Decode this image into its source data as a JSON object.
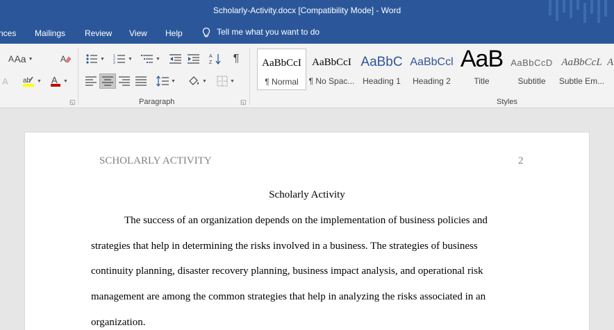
{
  "window": {
    "title": "Scholarly-Activity.docx [Compatibility Mode]  -  Word"
  },
  "ribbon_tabs": [
    {
      "label": "nces"
    },
    {
      "label": "Mailings"
    },
    {
      "label": "Review"
    },
    {
      "label": "View"
    },
    {
      "label": "Help"
    }
  ],
  "tell_me": {
    "label": "Tell me what you want to do",
    "icon": "lightbulb-icon"
  },
  "groups": {
    "paragraph_label": "Paragraph",
    "styles_label": "Styles"
  },
  "font_controls": {
    "font_size_glyph": "Aa",
    "grow_glyph": "A",
    "color_accent": "#c00000",
    "highlight_accent": "#ffff00"
  },
  "styles": [
    {
      "sample": "AaBbCcI",
      "name": "¶ Normal"
    },
    {
      "sample": "AaBbCcI",
      "name": "¶ No Spac..."
    },
    {
      "sample": "AaBbC",
      "name": "Heading 1"
    },
    {
      "sample": "AaBbCcl",
      "name": "Heading 2"
    },
    {
      "sample": "AaB",
      "name": "Title"
    },
    {
      "sample": "AaBbCcD",
      "name": "Subtitle"
    },
    {
      "sample": "AaBbCcL",
      "name": "Subtle Em..."
    }
  ],
  "document": {
    "header_left": "SCHOLARLY ACTIVITY",
    "header_page_number": "2",
    "title": "Scholarly Activity",
    "paragraph_lines": [
      "The success of an organization depends on the implementation of business policies and",
      "strategies that help in determining the risks involved in a business. The strategies of business",
      "continuity planning, disaster recovery planning, business impact analysis, and operational risk",
      "management are among the common strategies that help in analyzing the risks associated in an",
      "organization."
    ]
  },
  "colors": {
    "brand": "#2b579a",
    "ribbon_bg": "#f3f3f3",
    "canvas_bg": "#e6e6e6",
    "heading_blue": "#2f5496"
  }
}
